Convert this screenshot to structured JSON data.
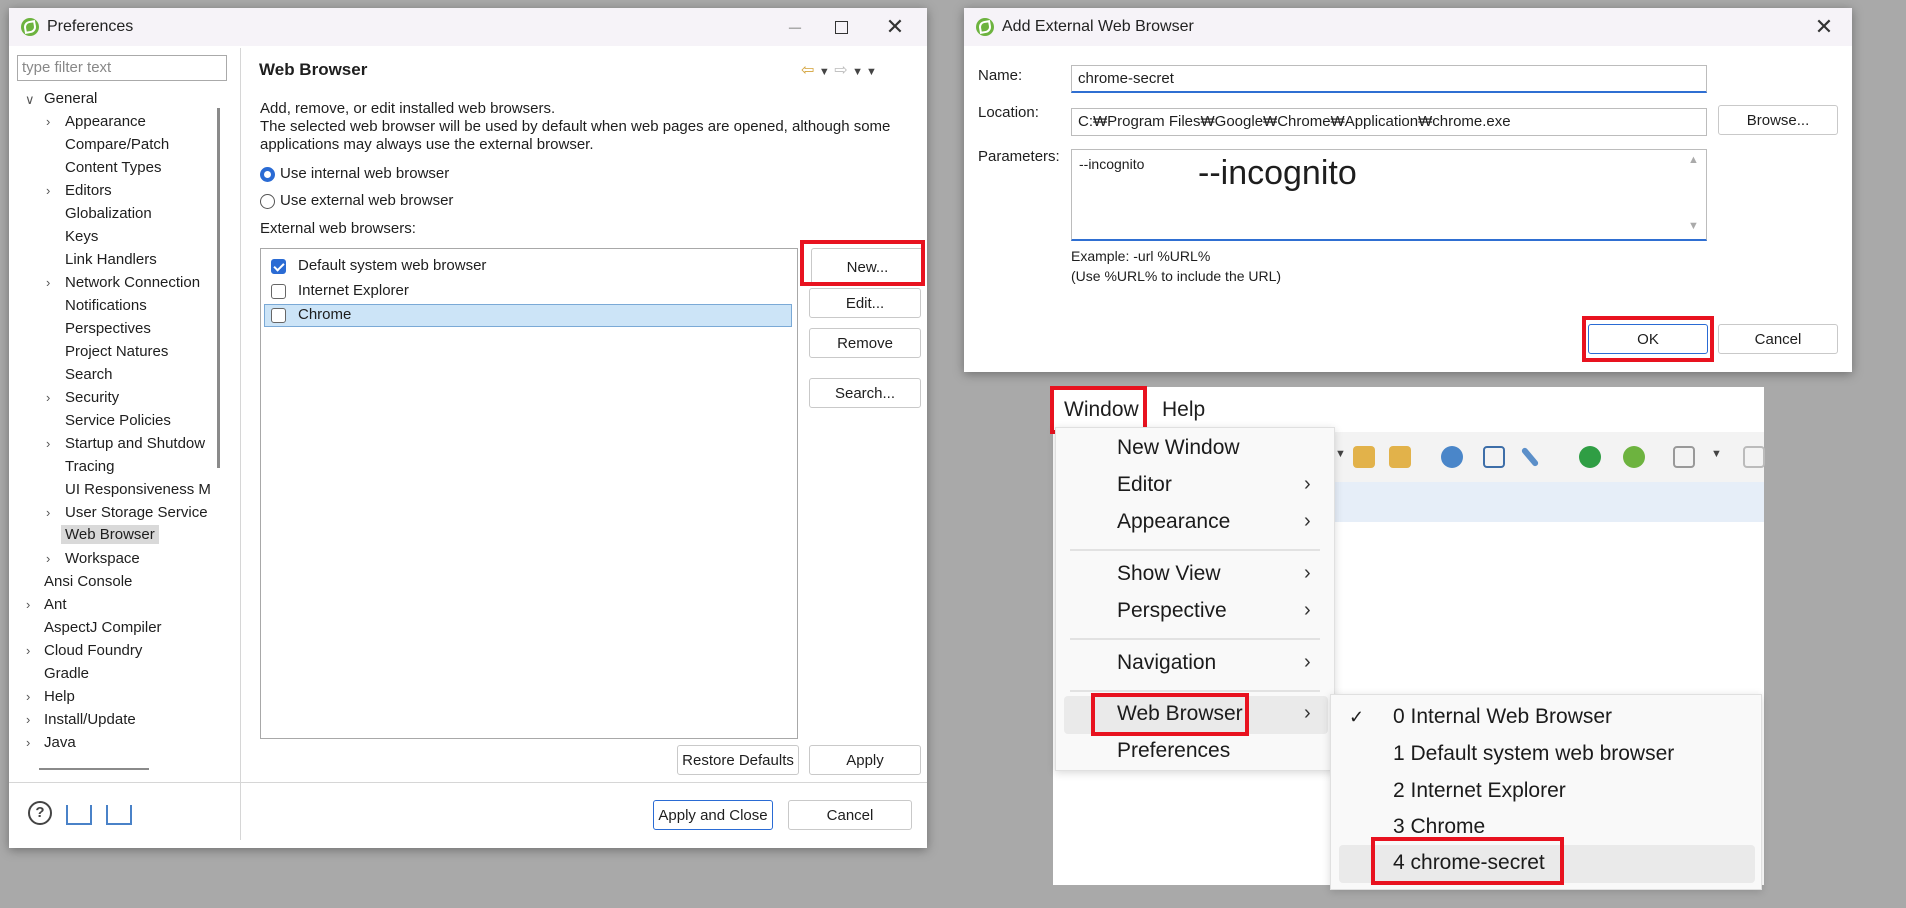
{
  "prefs": {
    "title": "Preferences",
    "filter_placeholder": "type filter text",
    "page_title": "Web Browser",
    "desc": [
      "Add, remove, or edit installed web browsers.",
      "The selected web browser will be used by default when web pages are opened, although some",
      "applications may always use the external browser."
    ],
    "radio_internal": "Use internal web browser",
    "radio_external": "Use external web browser",
    "external_label": "External web browsers:",
    "browsers": [
      "Default system web browser",
      "Internet Explorer",
      "Chrome"
    ],
    "btn_new": "New...",
    "btn_edit": "Edit...",
    "btn_remove": "Remove",
    "btn_search": "Search...",
    "btn_restore": "Restore Defaults",
    "btn_apply": "Apply",
    "btn_apply_close": "Apply and Close",
    "btn_cancel": "Cancel",
    "tree": [
      "General",
      "Appearance",
      "Compare/Patch",
      "Content Types",
      "Editors",
      "Globalization",
      "Keys",
      "Link Handlers",
      "Network Connection",
      "Notifications",
      "Perspectives",
      "Project Natures",
      "Search",
      "Security",
      "Service Policies",
      "Startup and Shutdow",
      "Tracing",
      "UI Responsiveness M",
      "User Storage Service",
      "Web Browser",
      "Workspace",
      "Ansi Console",
      "Ant",
      "AspectJ Compiler",
      "Cloud Foundry",
      "Gradle",
      "Help",
      "Install/Update",
      "Java"
    ]
  },
  "addDialog": {
    "title": "Add External Web Browser",
    "name_label": "Name:",
    "name_value": "chrome-secret",
    "location_label": "Location:",
    "location_value": "C:₩Program Files₩Google₩Chrome₩Application₩chrome.exe",
    "browse": "Browse...",
    "params_label": "Parameters:",
    "params_value": "--incognito",
    "params_big": "--incognito",
    "example1": "Example: -url %URL%",
    "example2": "(Use %URL% to include the URL)",
    "ok": "OK",
    "cancel": "Cancel"
  },
  "menu": {
    "bar": [
      "Window",
      "Help"
    ],
    "items": [
      "New Window",
      "Editor",
      "Appearance",
      "Show View",
      "Perspective",
      "Navigation",
      "Web Browser",
      "Preferences"
    ],
    "submenu": [
      "0 Internal Web Browser",
      "1 Default system web browser",
      "2 Internet Explorer",
      "3 Chrome",
      "4 chrome-secret"
    ]
  },
  "colors": {
    "highlight": "#e8121f",
    "accent": "#2a6bd4",
    "spring": "#6db33f"
  }
}
